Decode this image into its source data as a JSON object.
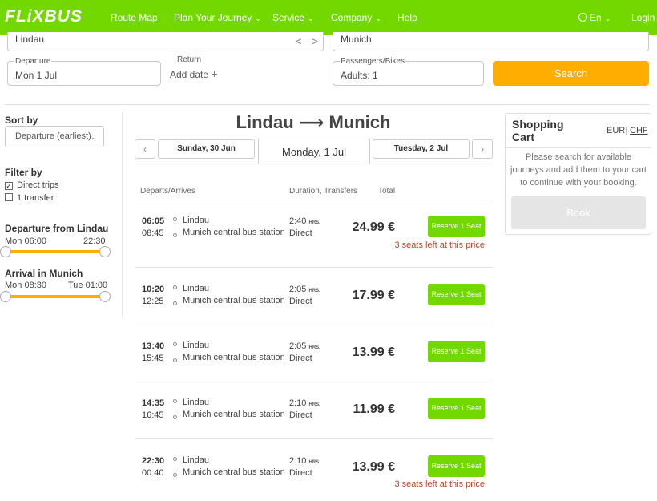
{
  "header": {
    "logo": "FLiXBUS",
    "nav": [
      {
        "label": "Route Map",
        "chevron": false
      },
      {
        "label": "Plan Your Journey",
        "chevron": true
      },
      {
        "label": "Service",
        "chevron": true
      },
      {
        "label": "Company",
        "chevron": true
      },
      {
        "label": "Help",
        "chevron": false
      }
    ],
    "language": "En",
    "login": "Login",
    "brand_color": "#73d700"
  },
  "search": {
    "from": "Lindau",
    "to": "Munich",
    "departure_label": "Departure",
    "departure_value": "Mon 1 Jul",
    "return_label": "Return",
    "return_value": "Add date",
    "passengers_label": "Passengers/Bikes",
    "passengers_value": "Adults: 1",
    "search_button": "Search",
    "accent_color": "#ffad00"
  },
  "filters": {
    "sort_title": "Sort by",
    "sort_value": "Departure (earliest)",
    "filter_title": "Filter by",
    "options": [
      {
        "label": "Direct trips",
        "checked": true
      },
      {
        "label": "1 transfer",
        "checked": false
      }
    ],
    "departure_title": "Departure from Lindau",
    "departure_min": "Mon 06:00",
    "departure_max": "22:30",
    "arrival_title": "Arrival in Munich",
    "arrival_min": "Mon 08:30",
    "arrival_max": "Tue 01:00"
  },
  "results": {
    "route_from": "Lindau",
    "route_arrow": "⟶",
    "route_to": "Munich",
    "prev_date": "Sunday, 30 Jun",
    "current_date": "Monday, 1 Jul",
    "next_date": "Tuesday, 2 Jul",
    "col_departs": "Departs/Arrives",
    "col_duration": "Duration, Transfers",
    "col_total": "Total",
    "rows": [
      {
        "dep": "06:05",
        "arr": "08:45",
        "from": "Lindau",
        "to": "Munich central bus station",
        "duration": "2:40",
        "unit": "HRS.",
        "transfers": "Direct",
        "price": "24.99 €",
        "button": "Reserve 1 Seat",
        "note": "3 seats left at this price"
      },
      {
        "dep": "10:20",
        "arr": "12:25",
        "from": "Lindau",
        "to": "Munich central bus station",
        "duration": "2:05",
        "unit": "HRS.",
        "transfers": "Direct",
        "price": "17.99 €",
        "button": "Reserve 1 Seat",
        "note": ""
      },
      {
        "dep": "13:40",
        "arr": "15:45",
        "from": "Lindau",
        "to": "Munich central bus station",
        "duration": "2:05",
        "unit": "HRS.",
        "transfers": "Direct",
        "price": "13.99 €",
        "button": "Reserve 1 Seat",
        "note": ""
      },
      {
        "dep": "14:35",
        "arr": "16:45",
        "from": "Lindau",
        "to": "Munich central bus station",
        "duration": "2:10",
        "unit": "HRS.",
        "transfers": "Direct",
        "price": "11.99 €",
        "button": "Reserve 1 Seat",
        "note": ""
      },
      {
        "dep": "22:30",
        "arr": "00:40",
        "from": "Lindau",
        "to": "Munich central bus station",
        "duration": "2:10",
        "unit": "HRS.",
        "transfers": "Direct",
        "price": "13.99 €",
        "button": "Reserve 1 Seat",
        "note": "3 seats left at this price"
      }
    ]
  },
  "cart": {
    "title": "Shopping Cart",
    "currencies": [
      "EUR",
      "CHF"
    ],
    "message": "Please search for available journeys and add them to your cart to continue with your booking.",
    "book_button": "Book"
  }
}
